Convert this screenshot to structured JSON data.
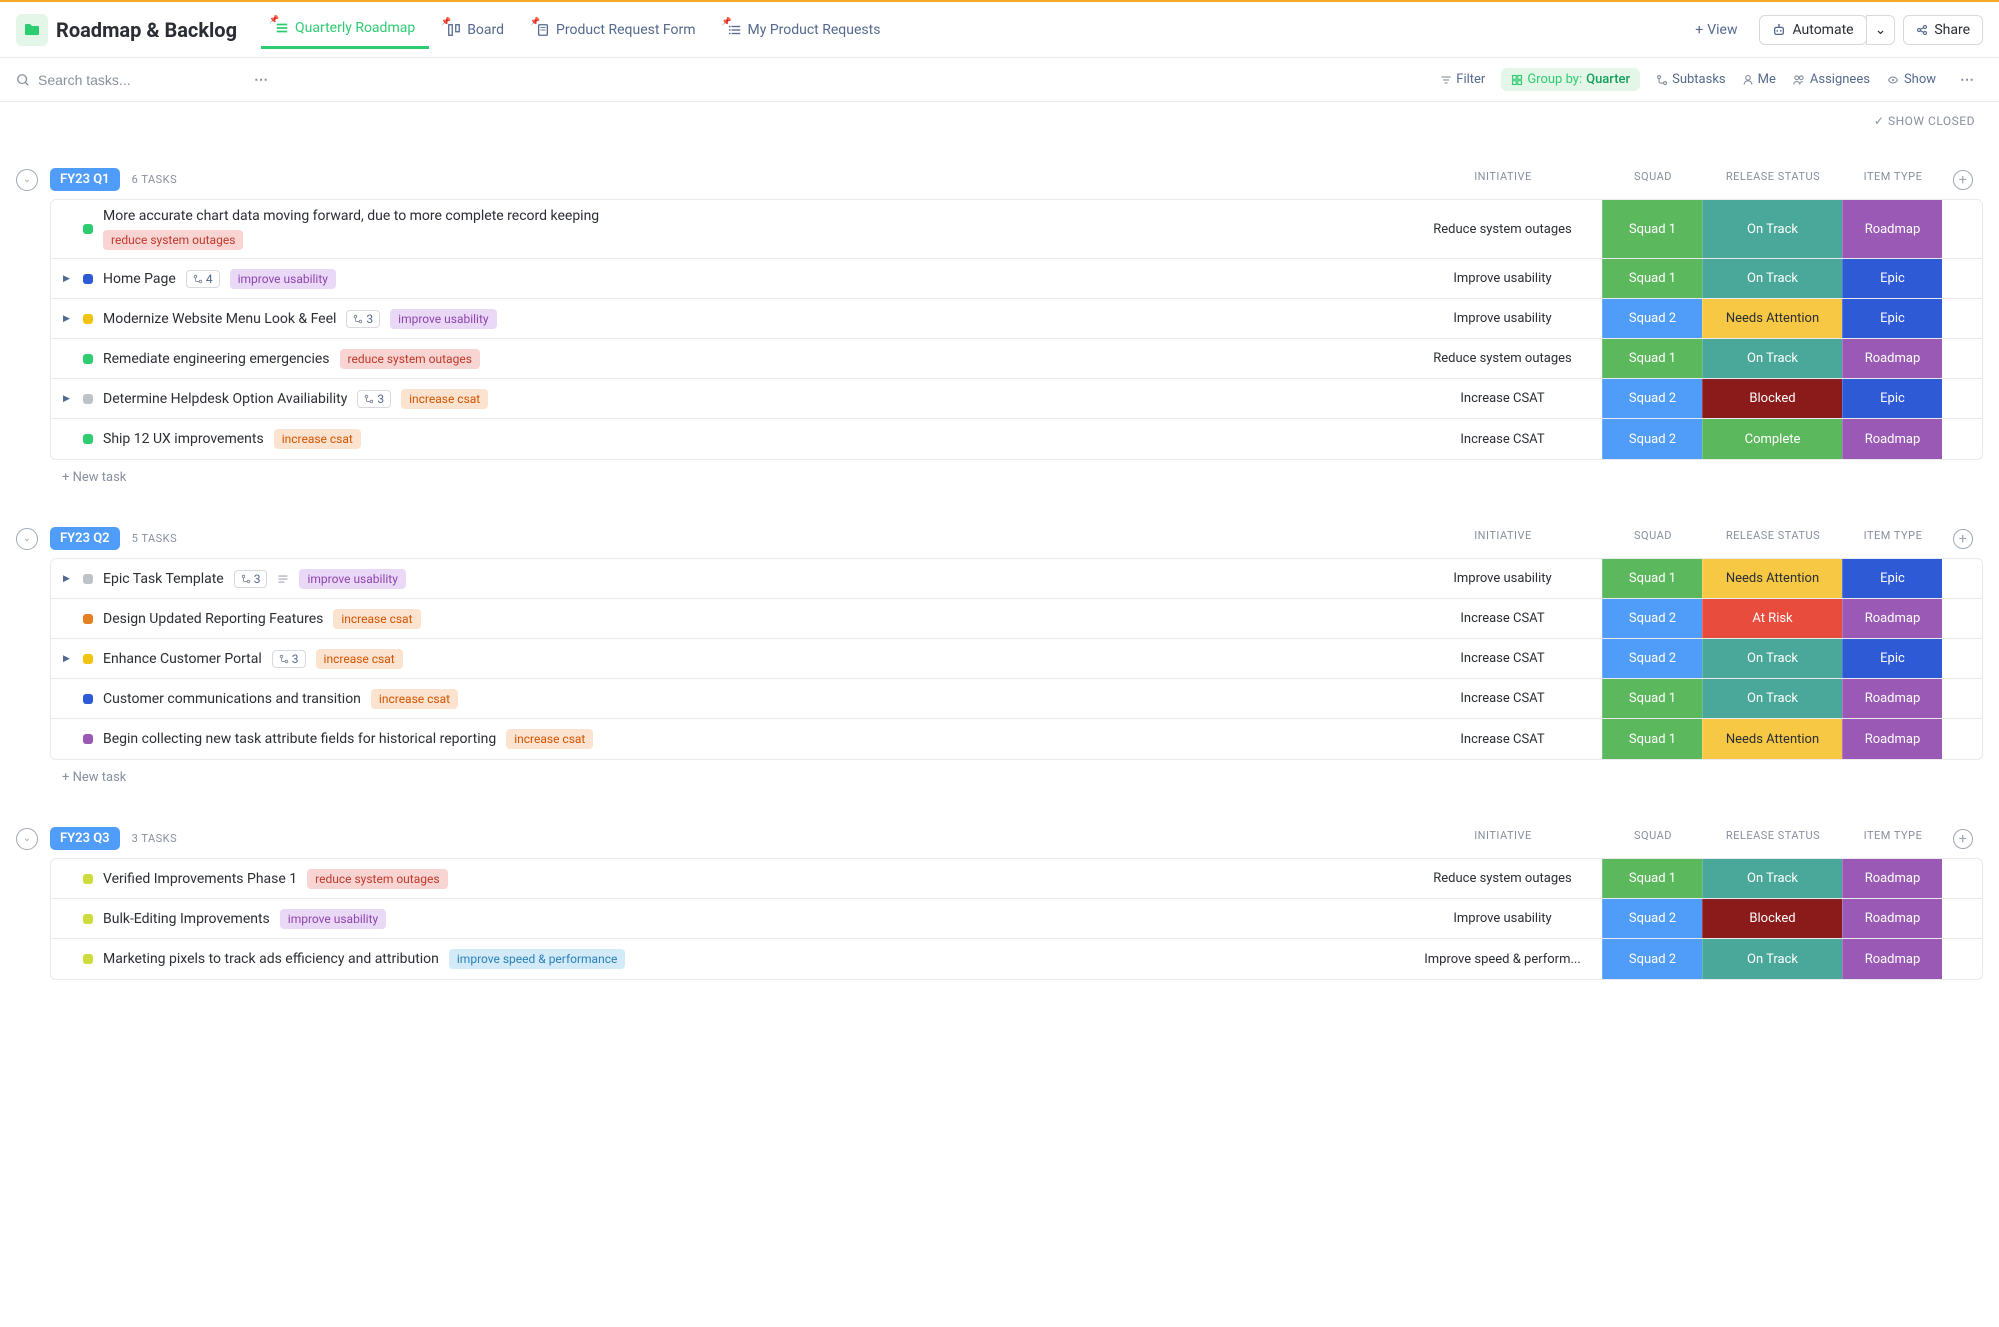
{
  "header": {
    "page_title": "Roadmap & Backlog",
    "tabs": [
      {
        "label": "Quarterly Roadmap",
        "active": true
      },
      {
        "label": "Board",
        "active": false
      },
      {
        "label": "Product Request Form",
        "active": false
      },
      {
        "label": "My Product Requests",
        "active": false
      }
    ],
    "add_view": "View",
    "automate": "Automate",
    "share": "Share"
  },
  "toolbar": {
    "search_placeholder": "Search tasks...",
    "filter": "Filter",
    "group_by_label": "Group by:",
    "group_by_value": "Quarter",
    "subtasks": "Subtasks",
    "me": "Me",
    "assignees": "Assignees",
    "show": "Show",
    "show_closed": "SHOW CLOSED"
  },
  "columns": {
    "initiative": "INITIATIVE",
    "squad": "SQUAD",
    "release_status": "RELEASE STATUS",
    "item_type": "ITEM TYPE"
  },
  "new_task_label": "+ New task",
  "colors": {
    "status_green": "#2ecc71",
    "status_blue": "#2e5ad6",
    "status_yellow": "#f1c40f",
    "status_orange": "#e67e22",
    "status_purple": "#9b59b6",
    "status_grey": "#bdc3c7",
    "status_lime": "#cddc39"
  },
  "groups": [
    {
      "name": "FY23 Q1",
      "count": "6 TASKS",
      "tasks": [
        {
          "title": "More accurate chart data moving forward, due to more complete record keeping",
          "status_color": "#2ecc71",
          "expandable": false,
          "tags": [
            {
              "text": "reduce system outages",
              "cls": "tag-red"
            }
          ],
          "tags_below": true,
          "initiative": "Reduce system outages",
          "squad": {
            "text": "Squad 1",
            "cls": "bg-green"
          },
          "release": {
            "text": "On Track",
            "cls": "bg-teal"
          },
          "type": {
            "text": "Roadmap",
            "cls": "bg-purple"
          }
        },
        {
          "title": "Home Page",
          "status_color": "#2e5ad6",
          "expandable": true,
          "subtasks": "4",
          "tags": [
            {
              "text": "improve usability",
              "cls": "tag-purple"
            }
          ],
          "initiative": "Improve usability",
          "squad": {
            "text": "Squad 1",
            "cls": "bg-green"
          },
          "release": {
            "text": "On Track",
            "cls": "bg-teal"
          },
          "type": {
            "text": "Epic",
            "cls": "bg-royalblue"
          }
        },
        {
          "title": "Modernize Website Menu Look & Feel",
          "status_color": "#f1c40f",
          "expandable": true,
          "subtasks": "3",
          "tags": [
            {
              "text": "improve usability",
              "cls": "tag-purple"
            }
          ],
          "initiative": "Improve usability",
          "squad": {
            "text": "Squad 2",
            "cls": "bg-blue"
          },
          "release": {
            "text": "Needs Attention",
            "cls": "bg-yellow"
          },
          "type": {
            "text": "Epic",
            "cls": "bg-royalblue"
          }
        },
        {
          "title": "Remediate engineering emergencies",
          "status_color": "#2ecc71",
          "expandable": false,
          "tags": [
            {
              "text": "reduce system outages",
              "cls": "tag-red"
            }
          ],
          "initiative": "Reduce system outages",
          "squad": {
            "text": "Squad 1",
            "cls": "bg-green"
          },
          "release": {
            "text": "On Track",
            "cls": "bg-teal"
          },
          "type": {
            "text": "Roadmap",
            "cls": "bg-purple"
          }
        },
        {
          "title": "Determine Helpdesk Option Availiability",
          "status_color": "#bdc3c7",
          "expandable": true,
          "subtasks": "3",
          "tags": [
            {
              "text": "increase csat",
              "cls": "tag-orange"
            }
          ],
          "initiative": "Increase CSAT",
          "squad": {
            "text": "Squad 2",
            "cls": "bg-blue"
          },
          "release": {
            "text": "Blocked",
            "cls": "bg-darkred"
          },
          "type": {
            "text": "Epic",
            "cls": "bg-royalblue"
          }
        },
        {
          "title": "Ship 12 UX improvements",
          "status_color": "#2ecc71",
          "expandable": false,
          "tags": [
            {
              "text": "increase csat",
              "cls": "tag-orange"
            }
          ],
          "initiative": "Increase CSAT",
          "squad": {
            "text": "Squad 2",
            "cls": "bg-blue"
          },
          "release": {
            "text": "Complete",
            "cls": "bg-green"
          },
          "type": {
            "text": "Roadmap",
            "cls": "bg-purple"
          }
        }
      ]
    },
    {
      "name": "FY23 Q2",
      "count": "5 TASKS",
      "tasks": [
        {
          "title": "Epic Task Template",
          "status_color": "#bdc3c7",
          "expandable": true,
          "subtasks": "3",
          "has_desc": true,
          "tags": [
            {
              "text": "improve usability",
              "cls": "tag-purple"
            }
          ],
          "initiative": "Improve usability",
          "squad": {
            "text": "Squad 1",
            "cls": "bg-green"
          },
          "release": {
            "text": "Needs Attention",
            "cls": "bg-yellow"
          },
          "type": {
            "text": "Epic",
            "cls": "bg-royalblue"
          }
        },
        {
          "title": "Design Updated Reporting Features",
          "status_color": "#e67e22",
          "expandable": false,
          "tags": [
            {
              "text": "increase csat",
              "cls": "tag-orange"
            }
          ],
          "initiative": "Increase CSAT",
          "squad": {
            "text": "Squad 2",
            "cls": "bg-blue"
          },
          "release": {
            "text": "At Risk",
            "cls": "bg-red"
          },
          "type": {
            "text": "Roadmap",
            "cls": "bg-purple"
          }
        },
        {
          "title": "Enhance Customer Portal",
          "status_color": "#f1c40f",
          "expandable": true,
          "subtasks": "3",
          "tags": [
            {
              "text": "increase csat",
              "cls": "tag-orange"
            }
          ],
          "initiative": "Increase CSAT",
          "squad": {
            "text": "Squad 2",
            "cls": "bg-blue"
          },
          "release": {
            "text": "On Track",
            "cls": "bg-teal"
          },
          "type": {
            "text": "Epic",
            "cls": "bg-royalblue"
          }
        },
        {
          "title": "Customer communications and transition",
          "status_color": "#2e5ad6",
          "expandable": false,
          "tags": [
            {
              "text": "increase csat",
              "cls": "tag-orange"
            }
          ],
          "initiative": "Increase CSAT",
          "squad": {
            "text": "Squad 1",
            "cls": "bg-green"
          },
          "release": {
            "text": "On Track",
            "cls": "bg-teal"
          },
          "type": {
            "text": "Roadmap",
            "cls": "bg-purple"
          }
        },
        {
          "title": "Begin collecting new task attribute fields for historical reporting",
          "status_color": "#9b59b6",
          "expandable": false,
          "tags": [
            {
              "text": "increase csat",
              "cls": "tag-orange"
            }
          ],
          "initiative": "Increase CSAT",
          "squad": {
            "text": "Squad 1",
            "cls": "bg-green"
          },
          "release": {
            "text": "Needs Attention",
            "cls": "bg-yellow"
          },
          "type": {
            "text": "Roadmap",
            "cls": "bg-purple"
          }
        }
      ]
    },
    {
      "name": "FY23 Q3",
      "count": "3 TASKS",
      "tasks": [
        {
          "title": "Verified Improvements Phase 1",
          "status_color": "#cddc39",
          "expandable": false,
          "tags": [
            {
              "text": "reduce system outages",
              "cls": "tag-red"
            }
          ],
          "initiative": "Reduce system outages",
          "squad": {
            "text": "Squad 1",
            "cls": "bg-green"
          },
          "release": {
            "text": "On Track",
            "cls": "bg-teal"
          },
          "type": {
            "text": "Roadmap",
            "cls": "bg-purple"
          }
        },
        {
          "title": "Bulk-Editing Improvements",
          "status_color": "#cddc39",
          "expandable": false,
          "tags": [
            {
              "text": "improve usability",
              "cls": "tag-purple"
            }
          ],
          "initiative": "Improve usability",
          "squad": {
            "text": "Squad 2",
            "cls": "bg-blue"
          },
          "release": {
            "text": "Blocked",
            "cls": "bg-darkred"
          },
          "type": {
            "text": "Roadmap",
            "cls": "bg-purple"
          }
        },
        {
          "title": "Marketing pixels to track ads efficiency and attribution",
          "status_color": "#cddc39",
          "expandable": false,
          "tags": [
            {
              "text": "improve speed & performance",
              "cls": "tag-blue"
            }
          ],
          "initiative": "Improve speed & perform...",
          "squad": {
            "text": "Squad 2",
            "cls": "bg-blue"
          },
          "release": {
            "text": "On Track",
            "cls": "bg-teal"
          },
          "type": {
            "text": "Roadmap",
            "cls": "bg-purple"
          }
        }
      ],
      "hide_new_task": true
    }
  ]
}
